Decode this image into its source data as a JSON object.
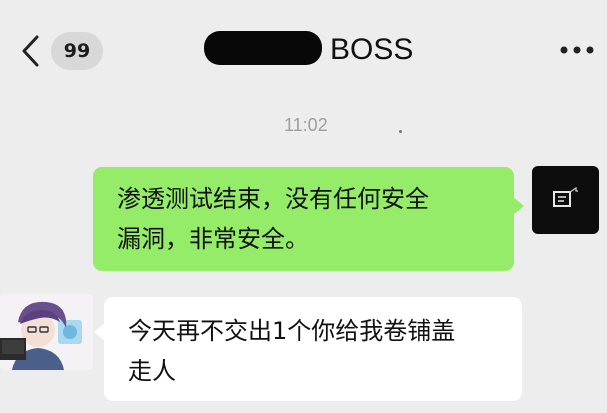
{
  "header": {
    "unread_count": "99",
    "title": "BOSS",
    "back_icon": "chevron-left-icon",
    "menu_icon": "more-icon"
  },
  "chat": {
    "timestamp": "11:02",
    "messages": [
      {
        "side": "right",
        "lines": [
          "渗透测试结束，没有任何安全",
          "漏洞，非常安全。"
        ]
      },
      {
        "side": "left",
        "lines": [
          "今天再不交出1个你给我卷铺盖",
          "走人"
        ]
      }
    ]
  },
  "colors": {
    "background": "#ededed",
    "outgoing_bubble": "#95ec69",
    "incoming_bubble": "#ffffff"
  }
}
